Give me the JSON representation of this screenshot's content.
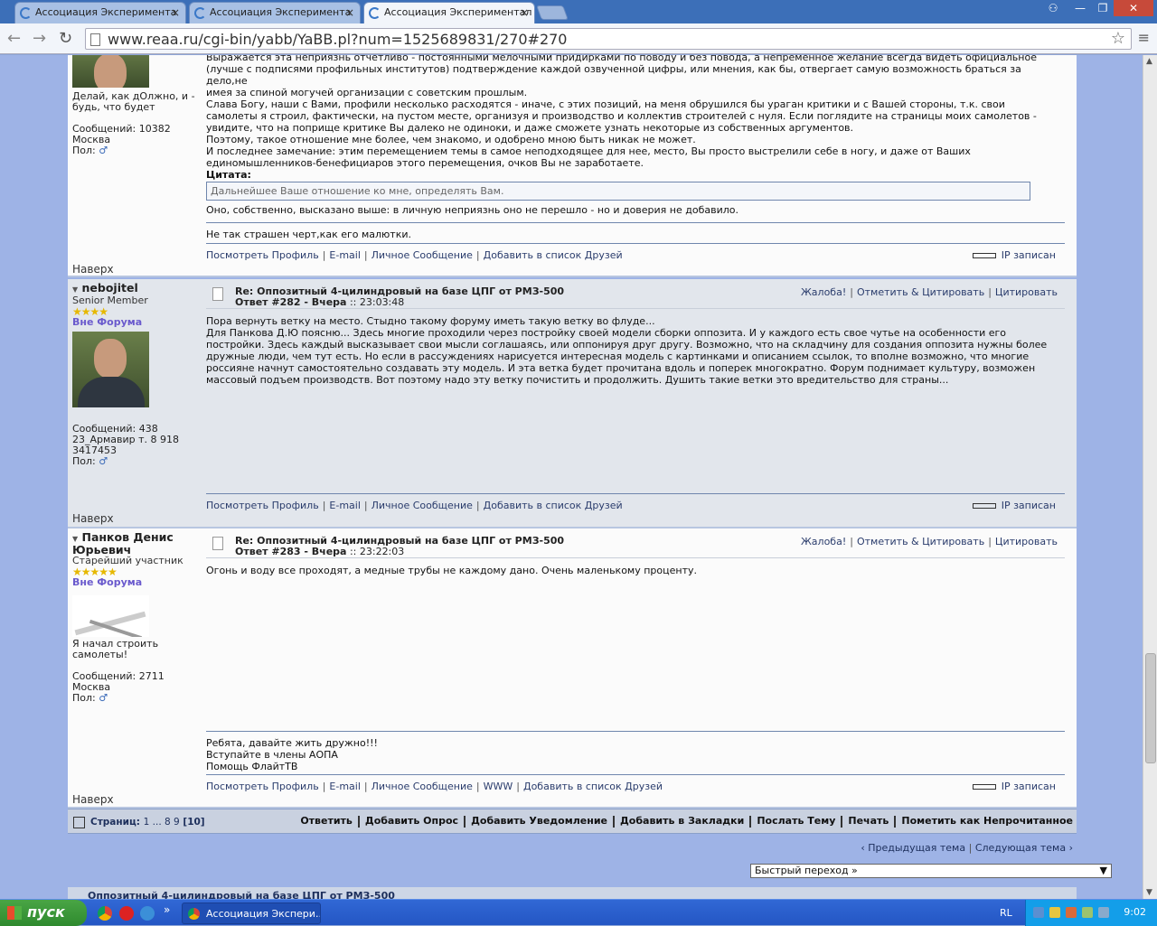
{
  "browser": {
    "tabs": [
      {
        "label": "Ассоциация Эксперимента",
        "close": "×"
      },
      {
        "label": "Ассоциация Эксперимента",
        "close": "×"
      },
      {
        "label": "Ассоциация Экспериментал",
        "close": "×"
      }
    ],
    "url": "www.reaa.ru/cgi-bin/yabb/YaBB.pl?num=1525689831/270#270",
    "window_controls": {
      "minimize": "—",
      "maximize": "❐",
      "close": "✕",
      "user": "⚇"
    }
  },
  "post1": {
    "author": {
      "signature": "Делай, как дОлжно, и - будь, что будет",
      "posts": "Сообщений: 10382",
      "location": "Москва",
      "gender": "Пол:"
    },
    "body_lines": [
      "Выражается эта неприязнь отчетливо - постоянными мелочными придирками по поводу и без повода, а непременное желание всегда видеть официальное",
      "(лучше с подписями профильных институтов) подтверждение каждой озвученной цифры, или мнения, как бы, отвергает самую возможность браться за дело,не",
      "имея за спиной могучей организации с советским прошлым.",
      "Слава Богу, наши с Вами, профили несколько расходятся - иначе, с этих позиций, на меня обрушился бы ураган критики и с Вашей стороны, т.к. свои",
      "самолеты я строил, фактически, на пустом месте, организуя и производство и коллектив строителей с нуля. Если поглядите на страницы моих самолетов  -",
      "увидите, что на поприще критике Вы далеко не одиноки, и даже сможете узнать некоторые из собственных аргументов.",
      "Поэтому, такое отношение мне более, чем знакомо, и одобрено мною быть никак не может.",
      "И последнее замечание: этим перемещением темы в самое неподходящее для нее, место, Вы просто выстрелили себе в ногу, и даже от Ваших",
      "единомышленников-бенефициаров этого перемещения, очков Вы не заработаете."
    ],
    "quote_label": "Цитата:",
    "quote": "Дальнейшее Ваше отношение ко мне, определять Вам.",
    "after_quote": "Оно, собственно, высказано выше: в личную неприязнь оно не перешло - но и доверия не добавило.",
    "sig": "Не так страшен черт,как его малютки.",
    "footer": [
      "Посмотреть Профиль",
      "E-mail",
      "Личное Сообщение",
      "Добавить в список Друзей"
    ],
    "ip": "IP записан",
    "top": "Наверх"
  },
  "post2": {
    "author": {
      "name": "nebojitel",
      "rank": "Senior Member",
      "stars": "★★★★",
      "status": "Вне Форума",
      "posts": "Сообщений: 438",
      "location": "23_Армавир т. 8 918 3417453",
      "gender": "Пол:"
    },
    "subject": "Re: Оппозитный 4-цилиндровый на базе ЦПГ от РМЗ-500",
    "reply": "Ответ #282 - Вчера",
    "time": ":: 23:03:48",
    "actions": [
      "Жалоба!",
      "Отметить & Цитировать",
      "Цитировать"
    ],
    "body_lines": [
      "Пора вернуть ветку на место. Стыдно такому форуму иметь такую ветку во флуде...",
      "Для Панкова Д.Ю поясню... Здесь многие проходили через постройку своей модели сборки оппозита. И у каждого есть свое чутье на особенности его",
      "постройки. Здесь каждый высказывает свои мысли соглашаясь, или оппонируя друг другу. Возможно, что на складчину для создания оппозита нужны более",
      "дружные люди, чем тут есть. Но если в рассуждениях нарисуется интересная модель с картинками и описанием ссылок, то вполне возможно, что многие",
      "россияне начнут самостоятельно создавать эту модель. И эта ветка будет прочитана вдоль и поперек многократно. Форум поднимает культуру, возможен",
      "массовый подъем производств. Вот поэтому надо эту ветку почистить и продолжить. Душить такие ветки это вредительство для страны..."
    ],
    "footer": [
      "Посмотреть Профиль",
      "E-mail",
      "Личное Сообщение",
      "Добавить в список Друзей"
    ],
    "ip": "IP записан",
    "top": "Наверх"
  },
  "post3": {
    "author": {
      "name": "Панков Денис Юрьевич",
      "rank": "Старейший участник",
      "stars": "★★★★★",
      "status": "Вне Форума",
      "signature": "Я начал строить самолеты!",
      "posts": "Сообщений: 2711",
      "location": "Москва",
      "gender": "Пол:"
    },
    "subject": "Re: Оппозитный 4-цилиндровый на базе ЦПГ от РМЗ-500",
    "reply": "Ответ #283 - Вчера",
    "time": ":: 23:22:03",
    "actions": [
      "Жалоба!",
      "Отметить & Цитировать",
      "Цитировать"
    ],
    "body": "Огонь и воду все проходят, а медные трубы не каждому дано. Очень маленькому проценту.",
    "sig_lines": [
      "Ребята, давайте жить дружно!!!",
      "Вступайте в члены АОПА",
      "Помощь ФлайтТВ"
    ],
    "footer": [
      "Посмотреть Профиль",
      "E-mail",
      "Личное Сообщение",
      "WWW",
      "Добавить в список Друзей"
    ],
    "ip": "IP записан",
    "top": "Наверх"
  },
  "pagination": {
    "label": "Страниц:",
    "pages": "1 ... 8 9",
    "current": "[10]",
    "links": [
      "Ответить",
      "Добавить Опрос",
      "Добавить Уведомление",
      "Добавить в Закладки",
      "Послать Тему",
      "Печать",
      "Пометить как Непрочитанное"
    ]
  },
  "prev_topic": "‹ Предыдущая тема",
  "next_topic": "Следующая тема ›",
  "jump": "Быстрый переход »",
  "bottom_title": "Оппозитный 4-цилиндровый на базе ЦПГ от РМЗ-500",
  "taskbar": {
    "start": "пуск",
    "window": "Ассоциация Экспери...",
    "lang": "RL",
    "clock": "9:02",
    "more": "»"
  }
}
